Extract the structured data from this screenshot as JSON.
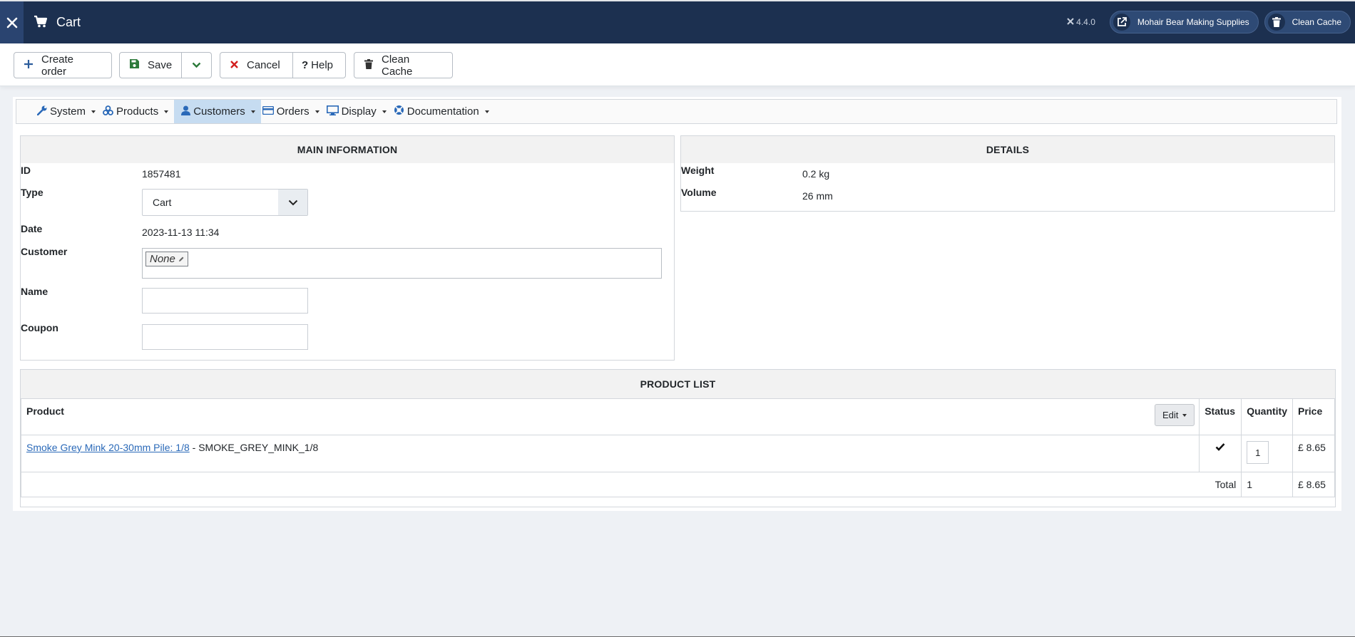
{
  "header": {
    "title": "Cart",
    "version": "4.4.0",
    "site_button": "Mohair Bear Making Supplies",
    "cache_button": "Clean Cache"
  },
  "toolbar": {
    "create_order": "Create order",
    "save": "Save",
    "cancel": "Cancel",
    "help": "Help",
    "clean_cache": "Clean Cache"
  },
  "nav": {
    "items": [
      {
        "label": "System",
        "icon": "wrench-icon"
      },
      {
        "label": "Products",
        "icon": "cubes-icon"
      },
      {
        "label": "Customers",
        "icon": "user-icon"
      },
      {
        "label": "Orders",
        "icon": "credit-card-icon"
      },
      {
        "label": "Display",
        "icon": "desktop-icon"
      },
      {
        "label": "Documentation",
        "icon": "lifebuoy-icon"
      }
    ],
    "active": "Customers"
  },
  "main_info": {
    "heading": "MAIN INFORMATION",
    "id_label": "ID",
    "id_value": "1857481",
    "type_label": "Type",
    "type_value": "Cart",
    "date_label": "Date",
    "date_value": "2023-11-13 11:34",
    "customer_label": "Customer",
    "customer_value": "None",
    "name_label": "Name",
    "name_value": "",
    "coupon_label": "Coupon",
    "coupon_value": ""
  },
  "details": {
    "heading": "DETAILS",
    "weight_label": "Weight",
    "weight_value": "0.2 kg",
    "volume_label": "Volume",
    "volume_value": "26 mm"
  },
  "product_list": {
    "heading": "PRODUCT LIST",
    "columns": {
      "product": "Product",
      "edit": "Edit",
      "status": "Status",
      "quantity": "Quantity",
      "price": "Price"
    },
    "rows": [
      {
        "name": "Smoke Grey Mink 20-30mm Pile: 1/8",
        "code": "- SMOKE_GREY_MINK_1/8",
        "status": "✔",
        "quantity": "1",
        "price": "£ 8.65"
      }
    ],
    "total_label": "Total",
    "total_quantity": "1",
    "total_price": "£ 8.65"
  },
  "colors": {
    "header_bg": "#1c3050",
    "active_nav": "#c6dcf1",
    "link": "#2a69b8",
    "cancel_icon": "#d21d1d",
    "chevron": "#2c7a3a"
  }
}
